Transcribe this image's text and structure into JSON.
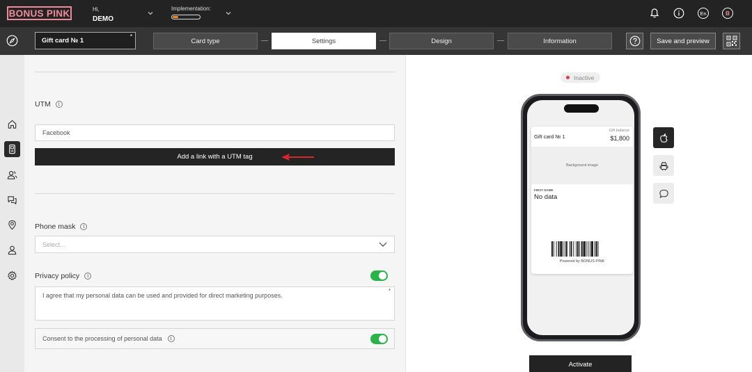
{
  "brand": {
    "logo_text": "BONUS PINK",
    "accent": "#f08b9c",
    "toggle_color": "#2bb34a"
  },
  "header": {
    "greeting": "Hi,",
    "user": "DEMO",
    "implementation_label": "Implementation:",
    "implementation_progress": 0.2,
    "language": "En",
    "avatar_letter": "B",
    "icons": [
      "bell-icon",
      "info-icon"
    ]
  },
  "toolbar": {
    "card_name": "Gift card № 1",
    "card_name_required": "*",
    "steps": [
      "Card type",
      "Settings",
      "Design",
      "Information"
    ],
    "active_step": "Settings",
    "save_label": "Save and preview"
  },
  "sidebar": {
    "items": [
      "home-icon",
      "card-icon",
      "users-icon",
      "chat-icon",
      "location-icon",
      "profile-icon",
      "settings-icon"
    ],
    "active": "card-icon"
  },
  "form": {
    "utm_label": "UTM",
    "utm_value": "Facebook",
    "add_link_label": "Add a link with a UTM tag",
    "phone_mask_label": "Phone mask",
    "phone_mask_placeholder": "Select...",
    "privacy_label": "Privacy policy",
    "privacy_enabled": true,
    "privacy_text": "I agree that my personal data can be used and provided for direct marketing purposes.",
    "privacy_required": "*",
    "consent_label": "Consent to the processing of personal data",
    "consent_enabled": true
  },
  "preview": {
    "status": "Inactive",
    "card_name": "Gift card № 1",
    "balance_label": "Gift balance",
    "balance_value": "$1,800",
    "background_label": "Background image",
    "first_name_label": "FIRST NAME",
    "first_name_value": "No data",
    "powered_by": "Powered by BONUS PINK",
    "platforms": [
      "apple-icon",
      "android-icon",
      "message-icon"
    ],
    "activate_label": "Activate"
  }
}
